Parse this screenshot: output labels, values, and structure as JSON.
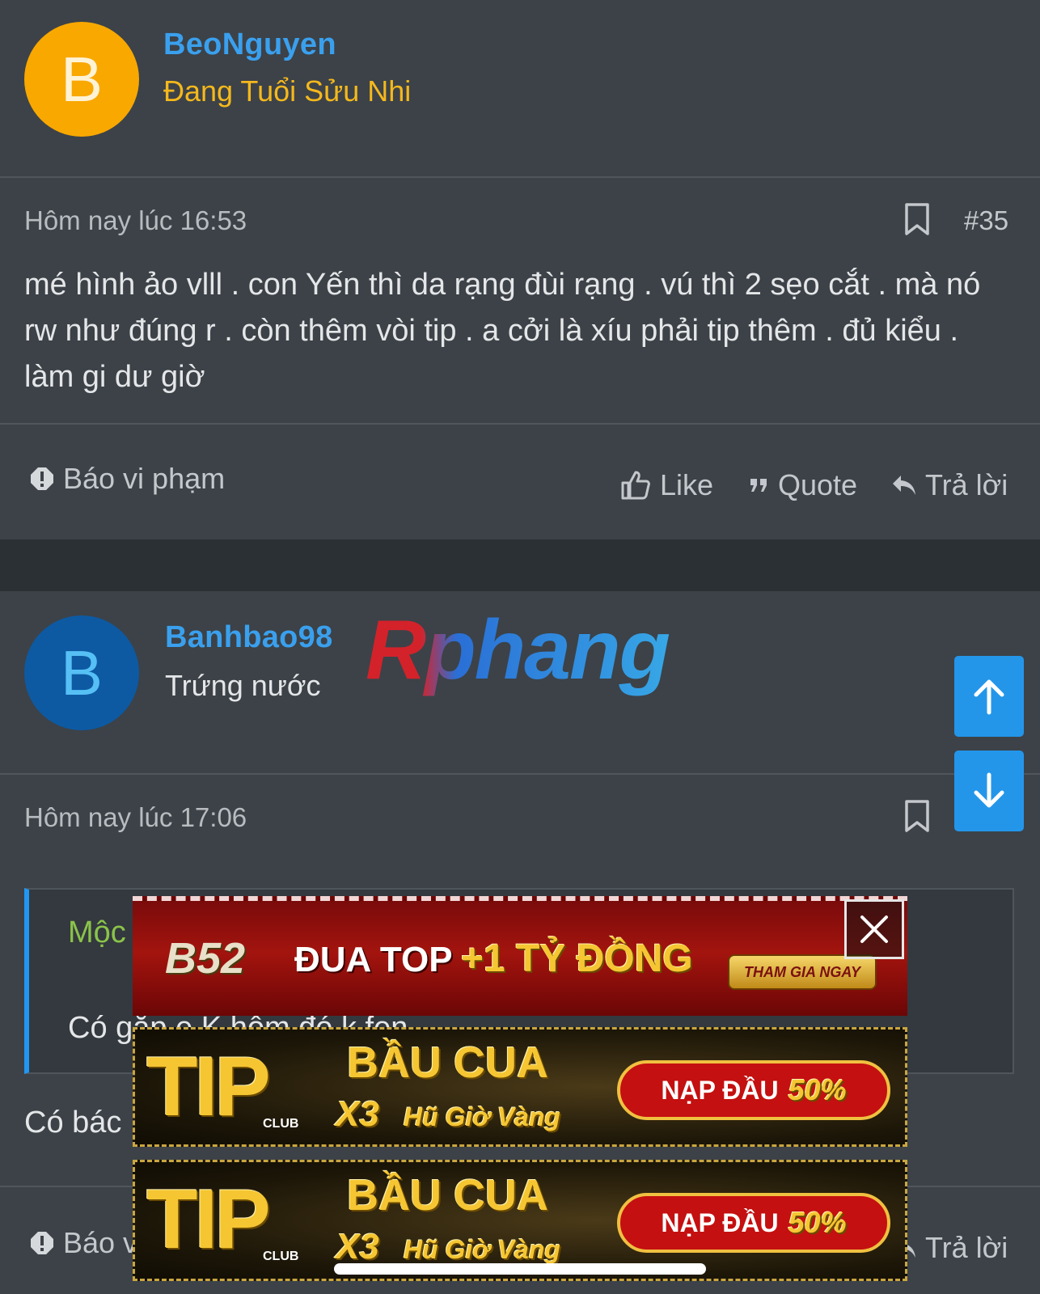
{
  "post1": {
    "username": "BeoNguyen",
    "avatar_letter": "B",
    "avatar_color": "#f9a800",
    "user_title": "Đang Tuổi Sửu Nhi",
    "user_title_color": "#f5b81c",
    "timestamp": "Hôm nay lúc 16:53",
    "post_number": "#35",
    "content": "mé hình ảo vlll . con Yến thì da rạng đùi rạng . vú thì 2 sẹo cắt . mà nó rw như đúng r . còn thêm vòi tip . a cởi là xíu phải tip thêm . đủ kiểu . làm gi dư giờ",
    "report_label": "Báo vi phạm",
    "like_label": "Like",
    "quote_label": "Quote",
    "reply_label": "Trả lời"
  },
  "post2": {
    "username": "Banhbao98",
    "avatar_letter": "B",
    "avatar_color": "#0d5aa3",
    "avatar_letter_color": "#56c0f5",
    "user_title": "Trứng nước",
    "watermark": "Rphang",
    "timestamp": "Hôm nay lúc 17:06",
    "quote_author": "Mộc",
    "quote_text": "Có gặp e K hôm đó k fen",
    "content_partial": "Có bác",
    "report_label": "Báo v",
    "reply_label": "Trả lời"
  },
  "scroll": {
    "up_icon": "arrow-up-icon",
    "down_icon": "arrow-down-icon"
  },
  "ads": {
    "b52": {
      "logo": "B52",
      "headline": "ĐUA TOP",
      "prize": "+1 TỶ ĐỒNG",
      "cta": "THAM GIA NGAY"
    },
    "tip": {
      "logo": "TIP",
      "logo_sub": "CLUB",
      "title": "BẦU CUA",
      "subtitle_x3": "X3",
      "subtitle": "Hũ Giờ Vàng",
      "pill_a": "NẠP ĐẦU",
      "pill_b": "50%"
    }
  },
  "colors": {
    "page_bg": "#2b3035",
    "card_bg": "#3c4248",
    "link_blue": "#3aa0ee",
    "nav_button": "#2396ea",
    "quote_author": "#8bc34a"
  }
}
